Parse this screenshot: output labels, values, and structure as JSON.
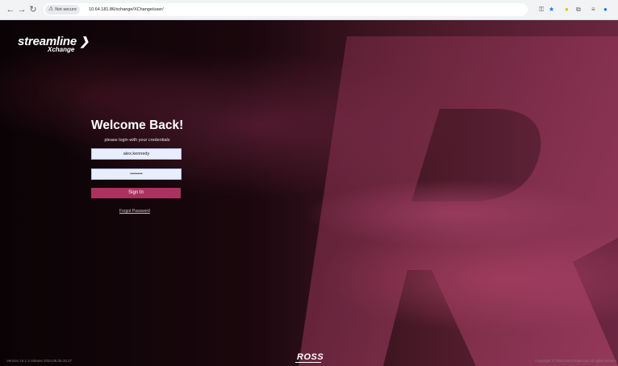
{
  "browser": {
    "back_icon": "←",
    "forward_icon": "→",
    "reload_icon": "↻",
    "security_label": "Not secure",
    "url": "10.64.181.86/xchange/XChange/user/"
  },
  "logo": {
    "primary": "streamline",
    "secondary": "Xchange"
  },
  "login": {
    "title": "Welcome Back!",
    "subtitle": "please login with your credentials",
    "username_value": "alex.kennedy",
    "password_value": "••••••••",
    "signin_label": "Sign In",
    "forgot_label": "Forgot Password"
  },
  "footer": {
    "version": "Version 16.1.3 release 2024.06.05.15.27",
    "brand": "ROSS",
    "copyright": "Copyright © 2012-2024 Ross Ltd. All rights Reserv"
  },
  "colors": {
    "signin_button": "#a8335f",
    "background_dark": "#0b0406",
    "background_pink": "#6b2640"
  }
}
